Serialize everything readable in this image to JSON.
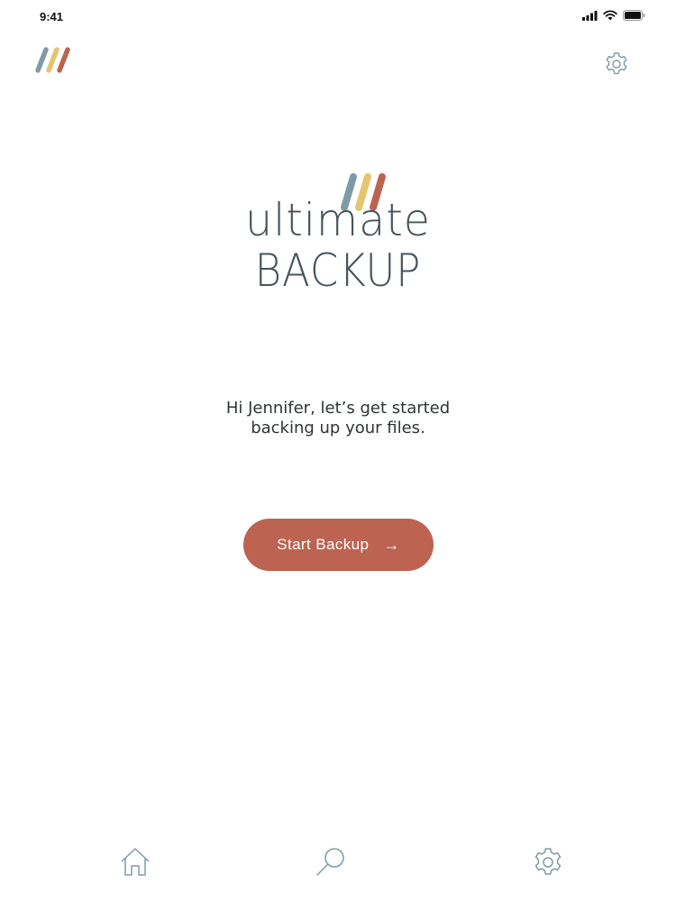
{
  "status_bar": {
    "time": "9:41",
    "icons": [
      "cellular-signal-icon",
      "wifi-icon",
      "battery-icon"
    ]
  },
  "header": {
    "brand_mark": "brand-stripes-icon",
    "settings_icon": "gear-icon"
  },
  "logo": {
    "line1": "ultimate",
    "line2": "BACKUP",
    "stripe_colors": [
      "#7f9aa7",
      "#e6c570",
      "#bd6351"
    ]
  },
  "greeting": {
    "line1": "Hi Jennifer, let’s get started",
    "line2": "backing up your files."
  },
  "start_button": {
    "label": "Start Backup",
    "arrow": "→",
    "color": "#bd6351"
  },
  "tab_bar": {
    "tabs": [
      {
        "icon": "home-icon"
      },
      {
        "icon": "search-icon"
      },
      {
        "icon": "gear-icon"
      }
    ]
  }
}
